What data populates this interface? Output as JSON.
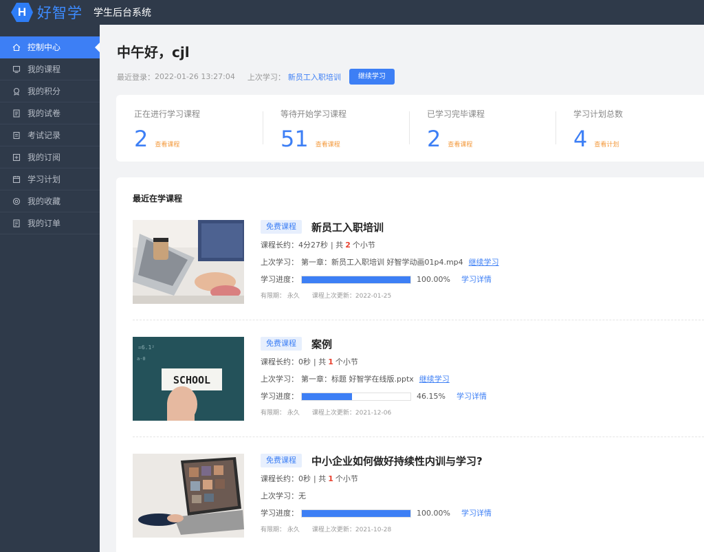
{
  "header": {
    "logo_letter": "H",
    "logo_text": "好智学",
    "system_title": "学生后台系统"
  },
  "sidebar": {
    "items": [
      {
        "label": "控制中心",
        "icon": "home-icon",
        "active": true
      },
      {
        "label": "我的课程",
        "icon": "monitor-icon",
        "active": false
      },
      {
        "label": "我的积分",
        "icon": "award-icon",
        "active": false
      },
      {
        "label": "我的试卷",
        "icon": "paper-icon",
        "active": false
      },
      {
        "label": "考试记录",
        "icon": "record-icon",
        "active": false
      },
      {
        "label": "我的订阅",
        "icon": "subscribe-icon",
        "active": false
      },
      {
        "label": "学习计划",
        "icon": "plan-icon",
        "active": false
      },
      {
        "label": "我的收藏",
        "icon": "favorite-icon",
        "active": false
      },
      {
        "label": "我的订单",
        "icon": "order-icon",
        "active": false
      }
    ]
  },
  "greeting": {
    "text": "中午好，cjl",
    "last_login_label": "最近登录：",
    "last_login_time": "2022-01-26 13:27:04",
    "last_study_label": "上次学习：",
    "last_study_course": "新员工入职培训",
    "continue_button": "继续学习"
  },
  "stats": [
    {
      "label": "正在进行学习课程",
      "value": "2",
      "link": "查看课程"
    },
    {
      "label": "等待开始学习课程",
      "value": "51",
      "link": "查看课程"
    },
    {
      "label": "已学习完毕课程",
      "value": "2",
      "link": "查看课程"
    },
    {
      "label": "学习计划总数",
      "value": "4",
      "link": "查看计划"
    }
  ],
  "recent": {
    "title": "最近在学课程",
    "courses": [
      {
        "tag": "免费课程",
        "name": "新员工入职培训",
        "duration_label": "课程长约：",
        "duration": "4分27秒",
        "sections_prefix": "| 共",
        "sections": "2",
        "sections_suffix": "个小节",
        "last_label": "上次学习：",
        "last": "第一章：新员工入职培训 好智学动画01p4.mp4",
        "continue_link": "继续学习",
        "progress_label": "学习进度：",
        "progress": 100,
        "progress_text": "100.00%",
        "detail_link": "学习详情",
        "validity": "有限期：  永久",
        "updated": "课程上次更新：2022-01-25"
      },
      {
        "tag": "免费课程",
        "name": "案例",
        "duration_label": "课程长约：",
        "duration": "0秒",
        "sections_prefix": "| 共",
        "sections": "1",
        "sections_suffix": "个小节",
        "last_label": "上次学习：",
        "last": "第一章：标题 好智学在线版.pptx",
        "continue_link": "继续学习",
        "progress_label": "学习进度：",
        "progress": 46.15,
        "progress_text": "46.15%",
        "detail_link": "学习详情",
        "validity": "有限期：  永久",
        "updated": "课程上次更新：2021-12-06",
        "thumb_text": "SCHOOL"
      },
      {
        "tag": "免费课程",
        "name": "中小企业如何做好持续性内训与学习?",
        "duration_label": "课程长约：",
        "duration": "0秒",
        "sections_prefix": "| 共",
        "sections": "1",
        "sections_suffix": "个小节",
        "last_label": "上次学习：",
        "last": "无",
        "continue_link": "",
        "progress_label": "学习进度：",
        "progress": 100,
        "progress_text": "100.00%",
        "detail_link": "学习详情",
        "validity": "有限期：  永久",
        "updated": "课程上次更新：2021-10-28"
      }
    ]
  },
  "colors": {
    "accent": "#3d7ff5",
    "sidebar_bg": "#2f3a4a",
    "orange_link": "#f39a3d",
    "red": "#e8412f"
  }
}
